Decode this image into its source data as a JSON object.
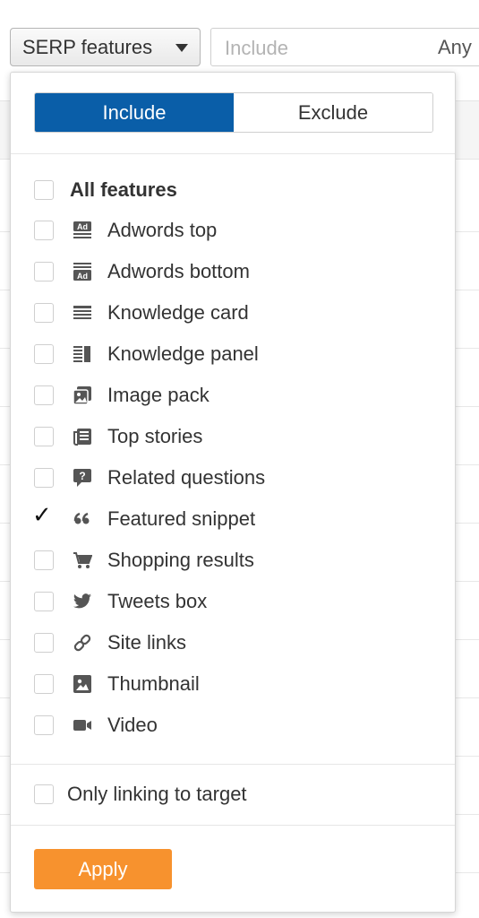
{
  "filter_bar": {
    "serp_button_label": "SERP features",
    "include_placeholder": "Include",
    "any_label": "Any"
  },
  "dropdown": {
    "toggle": {
      "include_label": "Include",
      "exclude_label": "Exclude",
      "active": "Include"
    },
    "all_features_label": "All features",
    "features": [
      {
        "label": "Adwords top",
        "icon": "ad-top-icon",
        "checked": false
      },
      {
        "label": "Adwords bottom",
        "icon": "ad-bottom-icon",
        "checked": false
      },
      {
        "label": "Knowledge card",
        "icon": "knowledge-card-icon",
        "checked": false
      },
      {
        "label": "Knowledge panel",
        "icon": "knowledge-panel-icon",
        "checked": false
      },
      {
        "label": "Image pack",
        "icon": "image-pack-icon",
        "checked": false
      },
      {
        "label": "Top stories",
        "icon": "newspaper-icon",
        "checked": false
      },
      {
        "label": "Related questions",
        "icon": "question-bubble-icon",
        "checked": false
      },
      {
        "label": "Featured snippet",
        "icon": "quote-icon",
        "checked": true
      },
      {
        "label": "Shopping results",
        "icon": "cart-icon",
        "checked": false
      },
      {
        "label": "Tweets box",
        "icon": "twitter-bird-icon",
        "checked": false
      },
      {
        "label": "Site links",
        "icon": "link-icon",
        "checked": false
      },
      {
        "label": "Thumbnail",
        "icon": "thumbnail-icon",
        "checked": false
      },
      {
        "label": "Video",
        "icon": "video-camera-icon",
        "checked": false
      }
    ],
    "only_linking_label": "Only linking to target",
    "apply_label": "Apply",
    "colors": {
      "active_toggle": "#0a5ea8",
      "apply_button": "#f7922e",
      "icon": "#555555"
    }
  }
}
